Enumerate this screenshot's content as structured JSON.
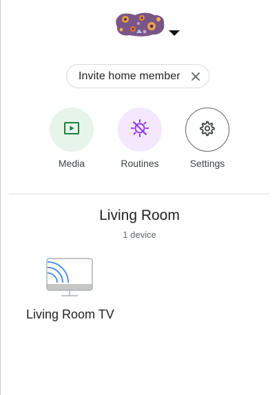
{
  "header": {
    "avatar_icon": "home-avatar-icon",
    "dropdown_icon": "caret-down-icon"
  },
  "invite_chip": {
    "label": "Invite home member",
    "close_icon": "close-icon"
  },
  "actions": [
    {
      "label": "Media",
      "icon": "media-play-icon",
      "bg_color": "#e6f4ea",
      "icon_color": "#188038"
    },
    {
      "label": "Routines",
      "icon": "routines-icon",
      "bg_color": "#f3e8fd",
      "icon_color": "#9334e6"
    },
    {
      "label": "Settings",
      "icon": "gear-icon",
      "bg_color": "#ffffff",
      "icon_color": "#3c4043"
    }
  ],
  "room": {
    "title": "Living Room",
    "device_count": "1 device",
    "devices": [
      {
        "name": "Living Room TV",
        "icon": "tv-cast-icon"
      }
    ]
  },
  "colors": {
    "cast_blue": "#4285f4",
    "divider": "#dadce0"
  }
}
